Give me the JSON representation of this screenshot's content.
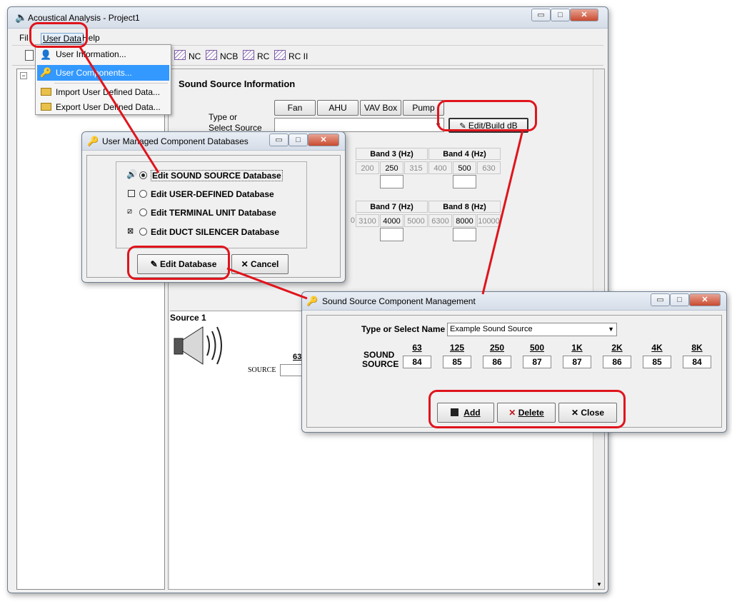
{
  "main_window": {
    "title": "Acoustical Analysis - Project1",
    "menu": [
      "Fil",
      "User Data",
      "Help"
    ],
    "toolbar_charts": [
      "NC",
      "NCB",
      "RC",
      "RC II"
    ]
  },
  "user_data_menu": {
    "items": [
      "User Information...",
      "User Components...",
      "Import User Defined Data...",
      "Export User Defined Data..."
    ]
  },
  "sound_source_panel": {
    "heading": "Sound Source Information",
    "type_tabs": [
      "Fan",
      "AHU",
      "VAV Box",
      "Pump"
    ],
    "type_label_line1": "Type or",
    "type_label_line2": "Select Source",
    "edit_build_label": "Edit/Build dB",
    "band_row1": [
      {
        "label": "Band 3 (Hz)",
        "freqs": [
          "200",
          "250",
          "315"
        ]
      },
      {
        "label": "Band 4 (Hz)",
        "freqs": [
          "400",
          "500",
          "630"
        ]
      }
    ],
    "band_row2": [
      {
        "label": "Band 7 (Hz)",
        "freqs": [
          "3100",
          "4000",
          "5000"
        ]
      },
      {
        "label": "Band 8 (Hz)",
        "freqs": [
          "6300",
          "8000",
          "10000"
        ]
      }
    ],
    "band_row2_partial": "0",
    "source_title": "Source 1",
    "source_freq": "63",
    "source_label": "SOURCE"
  },
  "db_dialog": {
    "title": "User Managed Component Databases",
    "options": [
      "Edit SOUND SOURCE Database",
      "Edit USER-DEFINED Database",
      "Edit TERMINAL UNIT Database",
      "Edit DUCT SILENCER Database"
    ],
    "selected_index": 0,
    "edit_button": "Edit Database",
    "cancel_button": "Cancel"
  },
  "component_dialog": {
    "title": "Sound Source Component Management",
    "name_label": "Type or Select Name",
    "name_value": "Example Sound Source",
    "row_label_line1": "SOUND",
    "row_label_line2": "SOURCE",
    "freqs": [
      "63",
      "125",
      "250",
      "500",
      "1K",
      "2K",
      "4K",
      "8K"
    ],
    "values": [
      "84",
      "85",
      "86",
      "87",
      "87",
      "86",
      "85",
      "84"
    ],
    "add_button": "Add",
    "delete_button": "Delete",
    "close_button": "Close"
  },
  "colors": {
    "highlight": "#e0141c",
    "menu_selection": "#3399ff"
  }
}
